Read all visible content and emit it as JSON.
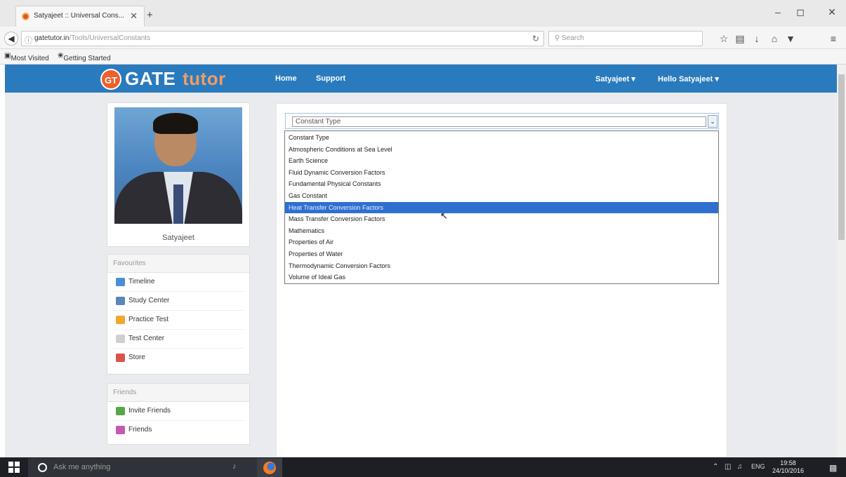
{
  "browser": {
    "tab_title": "Satyajeet :: Universal Cons...",
    "tab_close": "✕",
    "new_tab": "+",
    "window_buttons": [
      "–",
      "◻",
      "✕"
    ],
    "url_domain": "gatetutor.in",
    "url_path": "/Tools/UniversalConstants",
    "search_placeholder": "Search",
    "bookmarks": [
      "Most Visited",
      "Getting Started"
    ]
  },
  "site": {
    "logo_badge": "GT",
    "logo_gate": "GATE",
    "logo_tutor": "tutor",
    "nav": [
      "Home",
      "Support"
    ],
    "user_menu": "Satyajeet ▾",
    "greeting_menu": "Hello Satyajeet ▾"
  },
  "sidebar": {
    "profile_name": "Satyajeet",
    "favourites_title": "Favourites",
    "favourites": [
      {
        "label": "Timeline",
        "icon": "timeline-icon",
        "color": "#4a8fd4"
      },
      {
        "label": "Study Center",
        "icon": "study-center-icon",
        "color": "#5b86b8"
      },
      {
        "label": "Practice Test",
        "icon": "practice-test-icon",
        "color": "#f0a830"
      },
      {
        "label": "Test Center",
        "icon": "test-center-icon",
        "color": "#cfcfcf"
      },
      {
        "label": "Store",
        "icon": "store-icon",
        "color": "#d9534f"
      }
    ],
    "friends_title": "Friends",
    "friends": [
      {
        "label": "Invite Friends",
        "icon": "invite-friends-icon",
        "color": "#5aa64a"
      },
      {
        "label": "Friends",
        "icon": "friends-icon",
        "color": "#c25ab0"
      }
    ]
  },
  "main": {
    "select_value": "Constant Type",
    "options": [
      "Constant Type",
      "Atmospheric Conditions at Sea Level",
      "Earth Science",
      "Fluid Dynamic Conversion Factors",
      "Fundamental Physical Constants",
      "Gas Constant",
      "Heat Transfer Conversion Factors",
      "Mass Transfer Conversion Factors",
      "Mathematics",
      "Properties of Air",
      "Properties of Water",
      "Thermodynamic Conversion Factors",
      "Volume of Ideal Gas"
    ],
    "highlighted_option": "Heat Transfer Conversion Factors"
  },
  "taskbar": {
    "search_placeholder": "Ask me anything",
    "language": "ENG",
    "time": "19:58",
    "date": "24/10/2016"
  },
  "colors": {
    "header": "#2a7bbd",
    "highlight": "#2f6fd0",
    "logo_orange": "#ef5f2a"
  }
}
